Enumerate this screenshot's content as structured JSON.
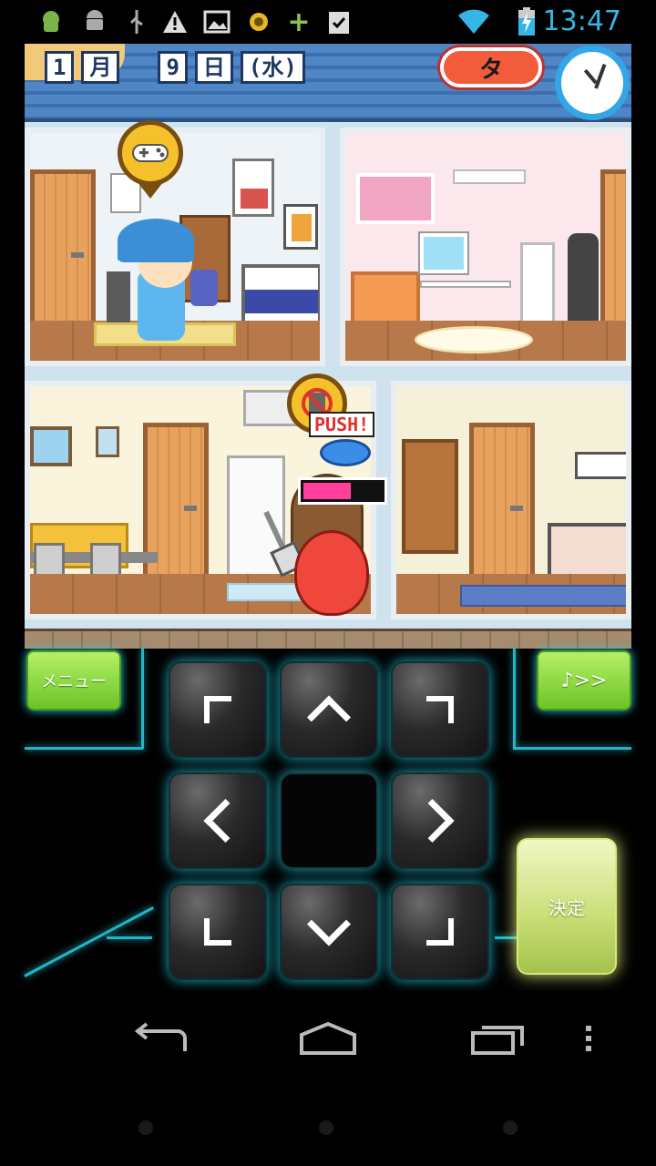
{
  "status_bar": {
    "time": "13:47",
    "icons": [
      "android-debug-icon",
      "android-icon",
      "usb-icon",
      "warning-icon",
      "image-icon",
      "sun-badge-icon",
      "plus-icon",
      "clipboard-check-icon",
      "wifi-icon",
      "battery-charging-icon"
    ]
  },
  "game": {
    "date": {
      "month": "1",
      "month_unit": "月",
      "day": "9",
      "day_unit": "日",
      "weekday": "(水)"
    },
    "time_of_day": "タ",
    "push_label": "PUSH!",
    "push_meter_level": 0.6,
    "bubble_icons": [
      "gamepad-icon",
      "no-trash-icon"
    ],
    "colors": {
      "roof": "#4f86c6",
      "time_badge": "#f25c3a",
      "clock_ring": "#33a6e8",
      "meter_fill": "#ff3f9b"
    }
  },
  "controls": {
    "menu_label": "メニュー",
    "music_label": "♪>>",
    "decide_label": "決定",
    "dpad": [
      "up-left",
      "up",
      "up-right",
      "left",
      "center",
      "right",
      "down-left",
      "down",
      "down-right"
    ],
    "glow_color": "#1fb6c7",
    "button_green": "#8fd940"
  },
  "nav": {
    "back_icon": "back-icon",
    "home_icon": "home-icon",
    "recents_icon": "recents-icon",
    "overflow_icon": "overflow-menu-icon"
  }
}
